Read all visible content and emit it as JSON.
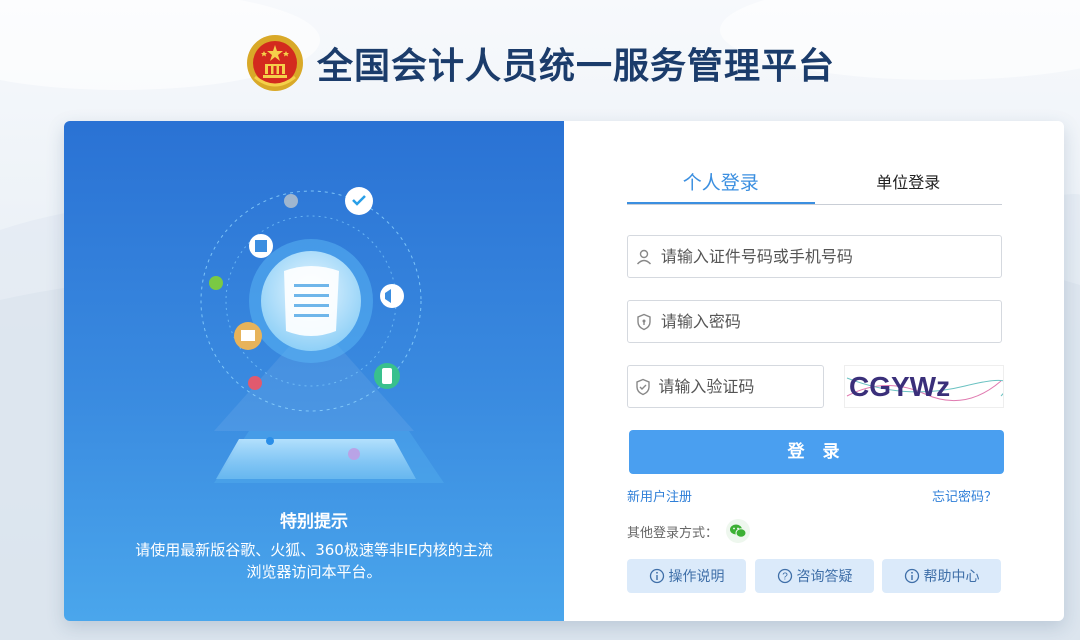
{
  "header": {
    "title": "全国会计人员统一服务管理平台"
  },
  "left_panel": {
    "tip_title": "特别提示",
    "tip_text": "请使用最新版谷歌、火狐、360极速等非IE内核的主流浏览器访问本平台。"
  },
  "login": {
    "tabs": [
      {
        "label": "个人登录",
        "active": true
      },
      {
        "label": "单位登录",
        "active": false
      }
    ],
    "id_placeholder": "请输入证件号码或手机号码",
    "password_placeholder": "请输入密码",
    "captcha_placeholder": "请输入验证码",
    "captcha_text": "CGYWz",
    "submit_label": "登 录",
    "register_link": "新用户注册",
    "forgot_link": "忘记密码？",
    "other_methods_label": "其他登录方式：",
    "other_methods_icon": "wechat-icon"
  },
  "help_buttons": [
    {
      "label": "操作说明",
      "icon": "info-icon"
    },
    {
      "label": "咨询答疑",
      "icon": "question-icon"
    },
    {
      "label": "帮助中心",
      "icon": "info-icon"
    }
  ],
  "colors": {
    "accent": "#3b8fe0",
    "button": "#4a9ff0",
    "title": "#1b3c6b",
    "left_panel_top": "#2a72d4",
    "left_panel_bottom": "#4aa6ec",
    "help_button_bg": "#dbeafa"
  }
}
